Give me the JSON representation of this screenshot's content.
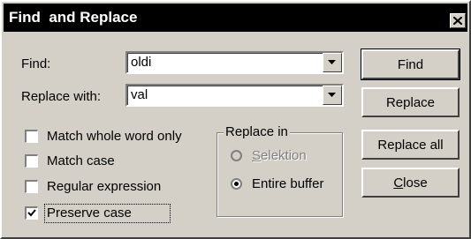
{
  "window": {
    "title": "Find  and Replace"
  },
  "find": {
    "label": "Find:",
    "value": "oldi"
  },
  "replace": {
    "label": "Replace with:",
    "value": "val"
  },
  "options": [
    {
      "label": "Match whole word only",
      "checked": false
    },
    {
      "label": "Match case",
      "checked": false
    },
    {
      "label": "Regular expression",
      "checked": false
    },
    {
      "label": "Preserve case",
      "checked": true
    }
  ],
  "replace_in": {
    "title": "Replace in",
    "selection_label": "Selektion",
    "entire_label": "Entire buffer"
  },
  "buttons": {
    "find": "Find",
    "replace": "Replace",
    "replace_all": "Replace all",
    "close": "Close"
  }
}
